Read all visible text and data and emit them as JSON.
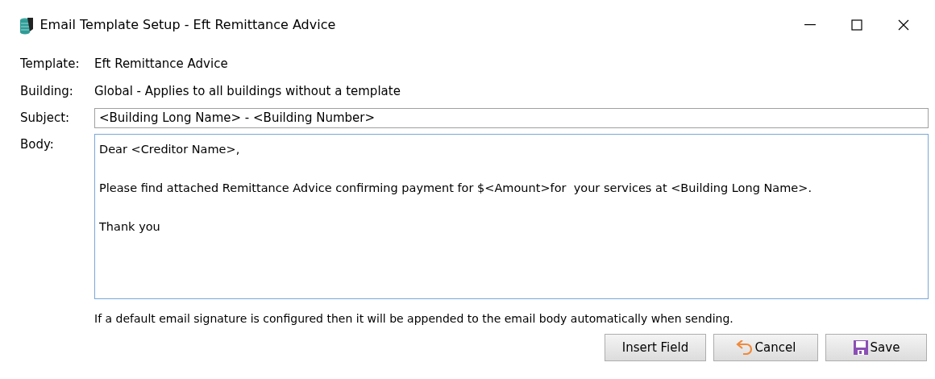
{
  "window": {
    "title": "Email Template Setup - Eft Remittance Advice"
  },
  "fields": [
    {
      "kind": "static",
      "label": "Template:",
      "value": "Eft Remittance Advice"
    },
    {
      "kind": "static",
      "label": "Building:",
      "value": "Global - Applies to all buildings without a template"
    },
    {
      "kind": "input",
      "label": "Subject:",
      "value": "<Building Long Name> - <Building Number>"
    },
    {
      "kind": "multiline",
      "label": "Body:",
      "paragraphs": [
        "Dear <Creditor Name>,",
        "Please find attached Remittance Advice confirming payment for $<Amount>for  your services at <Building Long Name>.",
        "Thank you"
      ]
    }
  ],
  "note": "If a default email signature is configured then it will be appended to the email body automatically when sending.",
  "buttons": [
    {
      "kind": "plain",
      "label": "Insert Field"
    },
    {
      "kind": "undo",
      "label": "Cancel"
    },
    {
      "kind": "save",
      "label": "Save"
    }
  ]
}
